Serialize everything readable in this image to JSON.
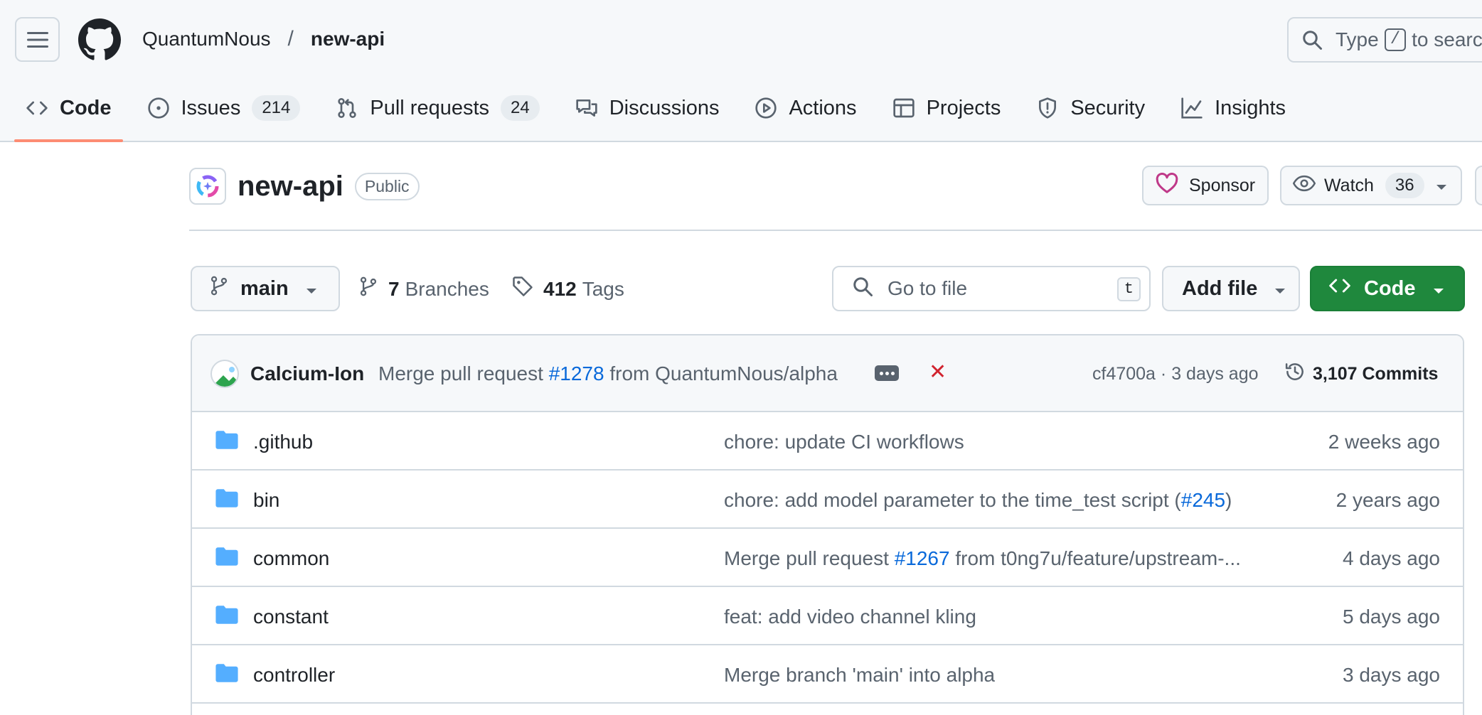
{
  "header": {
    "owner": "QuantumNous",
    "separator": "/",
    "repo": "new-api",
    "search": {
      "prefix": "Type",
      "key": "/",
      "suffix": "to search"
    }
  },
  "tabs": [
    {
      "label": "Code",
      "icon": "code-icon",
      "active": true
    },
    {
      "label": "Issues",
      "icon": "issue-opened-icon",
      "count": "214"
    },
    {
      "label": "Pull requests",
      "icon": "git-pull-request-icon",
      "count": "24"
    },
    {
      "label": "Discussions",
      "icon": "comment-discussion-icon"
    },
    {
      "label": "Actions",
      "icon": "play-icon"
    },
    {
      "label": "Projects",
      "icon": "table-icon"
    },
    {
      "label": "Security",
      "icon": "shield-icon"
    },
    {
      "label": "Insights",
      "icon": "graph-icon"
    }
  ],
  "repo_head": {
    "name": "new-api",
    "visibility": "Public",
    "sponsor_label": "Sponsor",
    "watch_label": "Watch",
    "watch_count": "36"
  },
  "toolbar": {
    "branch": "main",
    "branches_count": "7",
    "branches_label": "Branches",
    "tags_count": "412",
    "tags_label": "Tags",
    "goto_placeholder": "Go to file",
    "goto_key": "t",
    "add_file_label": "Add file",
    "code_label": "Code"
  },
  "commit": {
    "author": "Calcium-Ion",
    "message_prefix": "Merge pull request",
    "pr_link": "#1278",
    "message_suffix": "from QuantumNous/alpha",
    "hash": "cf4700a",
    "dot": "·",
    "age": "3 days ago",
    "commits_label": "3,107 Commits"
  },
  "files": [
    {
      "name": ".github",
      "msg_pre": "chore: update CI workflows",
      "msg_link": "",
      "msg_post": "",
      "age": "2 weeks ago"
    },
    {
      "name": "bin",
      "msg_pre": "chore: add model parameter to the time_test script (",
      "msg_link": "#245",
      "msg_post": ")",
      "age": "2 years ago"
    },
    {
      "name": "common",
      "msg_pre": "Merge pull request ",
      "msg_link": "#1267",
      "msg_post": " from t0ng7u/feature/upstream-...",
      "age": "4 days ago"
    },
    {
      "name": "constant",
      "msg_pre": "feat: add video channel kling",
      "msg_link": "",
      "msg_post": "",
      "age": "5 days ago"
    },
    {
      "name": "controller",
      "msg_pre": "Merge branch 'main' into alpha",
      "msg_link": "",
      "msg_post": "",
      "age": "3 days ago"
    }
  ],
  "colors": {
    "accent_underline": "#fd8c73",
    "code_button": "#1f883d",
    "link": "#0969da",
    "folder": "#54aeff",
    "sponsor_heart": "#bf3989",
    "failure_x": "#d1242f"
  }
}
